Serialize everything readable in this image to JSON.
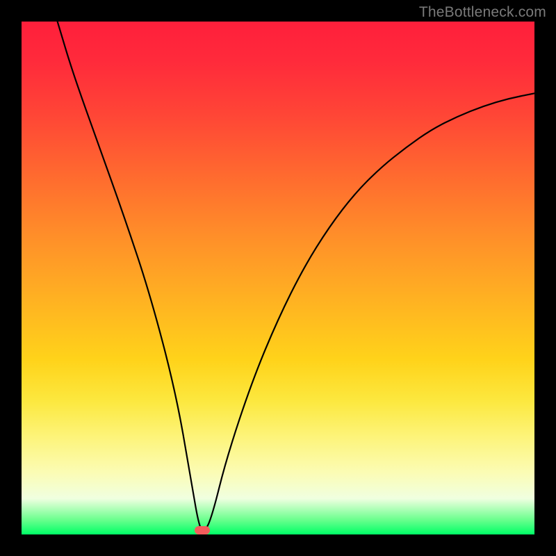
{
  "watermark": "TheBottleneck.com",
  "chart_data": {
    "type": "line",
    "title": "",
    "xlabel": "",
    "ylabel": "",
    "x_range": [
      0,
      100
    ],
    "y_range": [
      0,
      100
    ],
    "grid": false,
    "series": [
      {
        "name": "curve",
        "x": [
          7,
          10,
          15,
          20,
          25,
          30,
          33,
          34.5,
          35.5,
          37,
          40,
          45,
          50,
          55,
          60,
          65,
          70,
          75,
          80,
          85,
          90,
          95,
          100
        ],
        "y": [
          100,
          90,
          76,
          62,
          47,
          28,
          11,
          2,
          0.3,
          3,
          15,
          30,
          42,
          52,
          60,
          66.5,
          71.5,
          75.5,
          79,
          81.5,
          83.5,
          85,
          86
        ]
      }
    ],
    "marker": {
      "x": 35.2,
      "y": 0.8
    },
    "background": {
      "gradient": [
        "#ff1f3b",
        "#ffb122",
        "#fce83f",
        "#00ff66"
      ],
      "border_color": "#000000"
    }
  }
}
